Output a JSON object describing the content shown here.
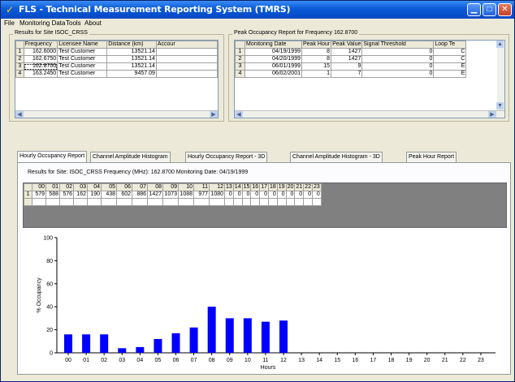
{
  "window": {
    "title": "FLS - Technical Measurement Reporting System (TMRS)"
  },
  "menu": [
    "File",
    "Monitoring Data",
    "Tools",
    "About"
  ],
  "results_panel": {
    "label": "Results for Site ISOC_CRSS",
    "columns": [
      "Frequency",
      "Licensee Name",
      "Distance (km)",
      "Accour"
    ],
    "rows": [
      {
        "n": "1",
        "frequency": "162.6000",
        "licensee": "Test Customer",
        "distance": "13521.14",
        "account": ""
      },
      {
        "n": "2",
        "frequency": "162.6750",
        "licensee": "Test Customer",
        "distance": "13521.14",
        "account": ""
      },
      {
        "n": "3",
        "frequency": "162.8700",
        "licensee": "Test Customer",
        "distance": "13521.14",
        "account": ""
      },
      {
        "n": "4",
        "frequency": "163.2450",
        "licensee": "Test Customer",
        "distance": "9457.09",
        "account": ""
      }
    ]
  },
  "peak_panel": {
    "label": "Peak Occupancy Report for Frequency 162.8700",
    "columns": [
      "Monitoring Date",
      "Peak Hour",
      "Peak Value",
      "Signal Threshold",
      "Loop Te"
    ],
    "rows": [
      {
        "n": "1",
        "date": "04/19/1999",
        "hour": "8",
        "value": "1427",
        "threshold": "0",
        "loop": "C"
      },
      {
        "n": "2",
        "date": "04/20/1999",
        "hour": "8",
        "value": "1427",
        "threshold": "0",
        "loop": "C"
      },
      {
        "n": "3",
        "date": "06/01/1999",
        "hour": "15",
        "value": "9",
        "threshold": "0",
        "loop": "E"
      },
      {
        "n": "4",
        "date": "06/02/2001",
        "hour": "1",
        "value": "7",
        "threshold": "0",
        "loop": "E"
      }
    ]
  },
  "tabs": [
    "Hourly Occupancy Report",
    "Channel Amplitude Histogram",
    "Hourly Occupancy Report - 3D",
    "Channel Amplitude Histogram - 3D",
    "Peak Hour Report"
  ],
  "report": {
    "results_line": "Results for Site: ISOC_CRSS  Frequency (MHz): 162.8700  Monitoring Date: 04/19/1999",
    "hour_headers": [
      "00",
      "01",
      "02",
      "03",
      "04",
      "05",
      "06",
      "07",
      "08",
      "09",
      "10",
      "11",
      "12",
      "13",
      "14",
      "15",
      "16",
      "17",
      "18",
      "19",
      "20",
      "21",
      "22",
      "23"
    ],
    "row_label": "1",
    "hour_values": [
      "579",
      "588",
      "576",
      "162",
      "190",
      "438",
      "602",
      "886",
      "1427",
      "1073",
      "1088",
      "977",
      "1080",
      "0",
      "0",
      "0",
      "0",
      "0",
      "0",
      "0",
      "0",
      "0",
      "0",
      "0"
    ]
  },
  "chart_data": {
    "type": "bar",
    "categories": [
      "00",
      "01",
      "02",
      "03",
      "04",
      "05",
      "06",
      "07",
      "08",
      "09",
      "10",
      "11",
      "12",
      "13",
      "14",
      "15",
      "16",
      "17",
      "18",
      "19",
      "20",
      "21",
      "22",
      "23"
    ],
    "values": [
      16,
      16,
      16,
      4,
      5,
      12,
      17,
      22,
      40,
      30,
      30,
      27,
      28,
      0,
      0,
      0,
      0,
      0,
      0,
      0,
      0,
      0,
      0,
      0
    ],
    "xlabel": "Hours",
    "ylabel": "% Occupancy",
    "ylim": [
      0,
      100
    ],
    "yticks": [
      "0",
      "20",
      "40",
      "60",
      "80",
      "100"
    ],
    "bar_color": "#0000ff",
    "grid": false
  }
}
